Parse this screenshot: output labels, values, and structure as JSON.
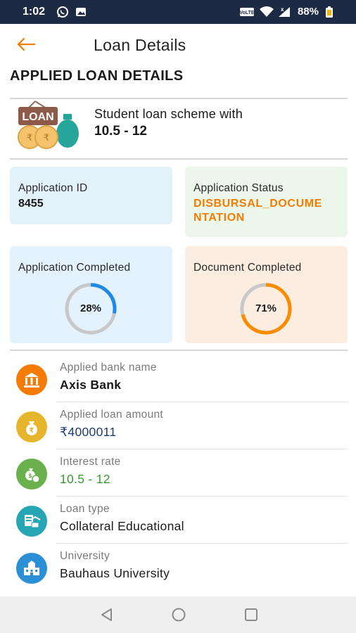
{
  "status_bar": {
    "time": "1:02",
    "battery": "88%",
    "icons": [
      "whatsapp-icon",
      "gallery-icon",
      "volte-icon",
      "wifi-icon",
      "signal-icon",
      "battery-icon"
    ]
  },
  "app_bar": {
    "title": "Loan Details",
    "back_icon": "arrow-left-icon"
  },
  "section": {
    "title": "APPLIED LOAN DETAILS"
  },
  "scheme": {
    "line1": "Student loan scheme with",
    "line2": "10.5 - 12",
    "icon": "loan-sign-icon"
  },
  "cards": {
    "application_id": {
      "label": "Application ID",
      "value": "8455"
    },
    "application_status": {
      "label": "Application Status",
      "value_line1": "DISBURSAL_DOCUME",
      "value_line2": "NTATION"
    },
    "application_completed": {
      "label": "Application Completed",
      "percent_text": "28%",
      "percent": 28
    },
    "document_completed": {
      "label": "Document Completed",
      "percent_text": "71%",
      "percent": 71
    }
  },
  "details": [
    {
      "label": "Applied bank name",
      "value": "Axis Bank",
      "icon": "bank-icon"
    },
    {
      "label": "Applied loan amount",
      "value": "₹4000011",
      "icon": "money-bag-icon"
    },
    {
      "label": "Interest rate",
      "value": "10.5 - 12",
      "icon": "interest-coins-icon"
    },
    {
      "label": "Loan type",
      "value": "Collateral Educational",
      "icon": "collateral-icon"
    },
    {
      "label": "University",
      "value": "Bauhaus University",
      "icon": "university-icon"
    }
  ],
  "colors": {
    "accent_orange": "#f57c00",
    "status_bar": "#1c2a43",
    "card_blue": "#e3f1fb",
    "card_green": "#eaf7ea",
    "card_light_blue": "#e3f2fd",
    "card_peach": "#fbeee0",
    "ring_blue": "#1e88e5",
    "ring_orange": "#fb8c00",
    "ring_track": "#c8c8c8",
    "amount_blue": "#1f3b73",
    "interest_green": "#3a9a2f"
  },
  "nav_bar": {
    "buttons": [
      "back-triangle-icon",
      "home-circle-icon",
      "recents-square-icon"
    ]
  }
}
